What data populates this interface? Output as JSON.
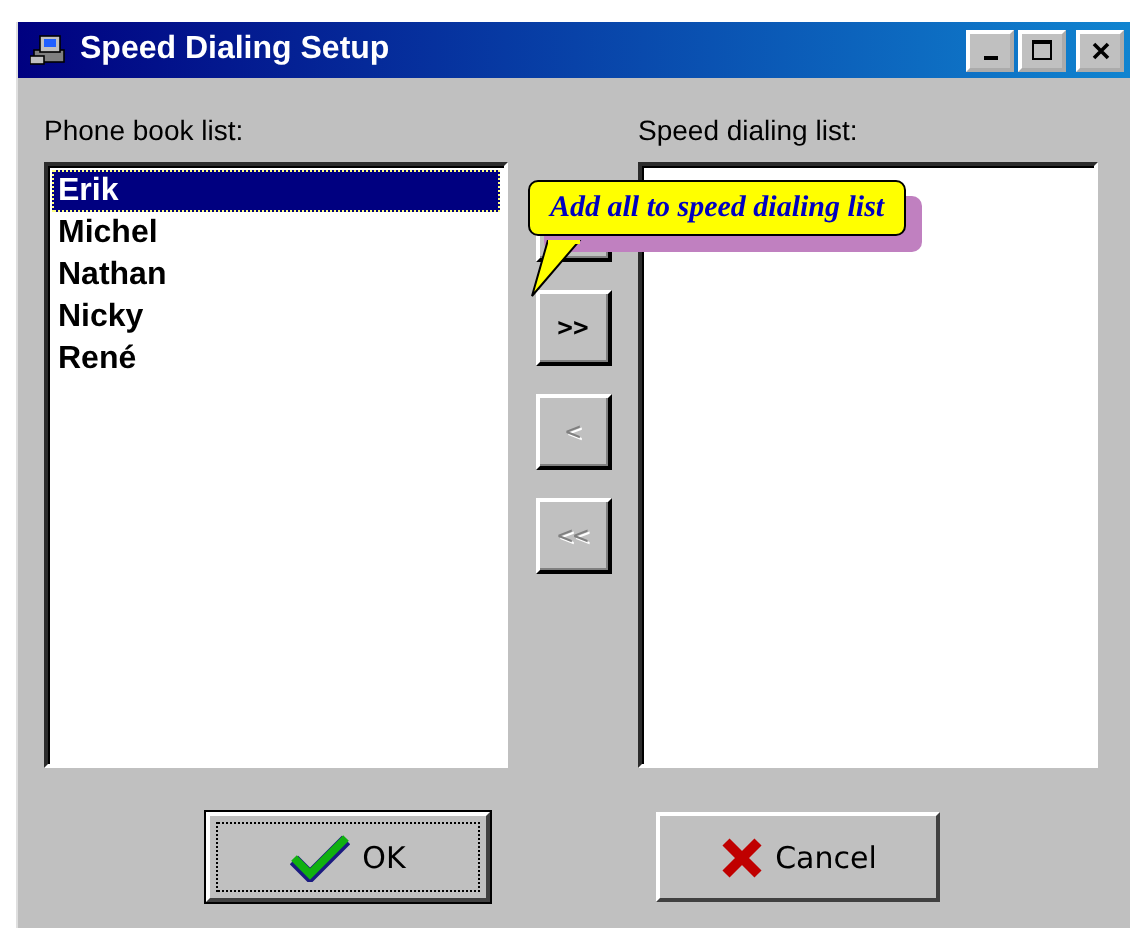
{
  "window": {
    "title": "Speed Dialing Setup"
  },
  "phone_book": {
    "label": "Phone book list:",
    "items": [
      {
        "name": "Erik",
        "selected": true
      },
      {
        "name": "Michel",
        "selected": false
      },
      {
        "name": "Nathan",
        "selected": false
      },
      {
        "name": "Nicky",
        "selected": false
      },
      {
        "name": "René",
        "selected": false
      }
    ]
  },
  "speed_list": {
    "label": "Speed dialing list:"
  },
  "move_buttons": [
    {
      "label": ">>",
      "disabled": false
    },
    {
      "label": "<",
      "disabled": true
    },
    {
      "label": "<<",
      "disabled": true
    }
  ],
  "tooltip": {
    "text": "Add all to speed dialing list"
  },
  "buttons": [
    {
      "label": "OK",
      "kind": "ok",
      "focused": true
    },
    {
      "label": "Cancel",
      "kind": "cancel",
      "focused": false
    }
  ]
}
